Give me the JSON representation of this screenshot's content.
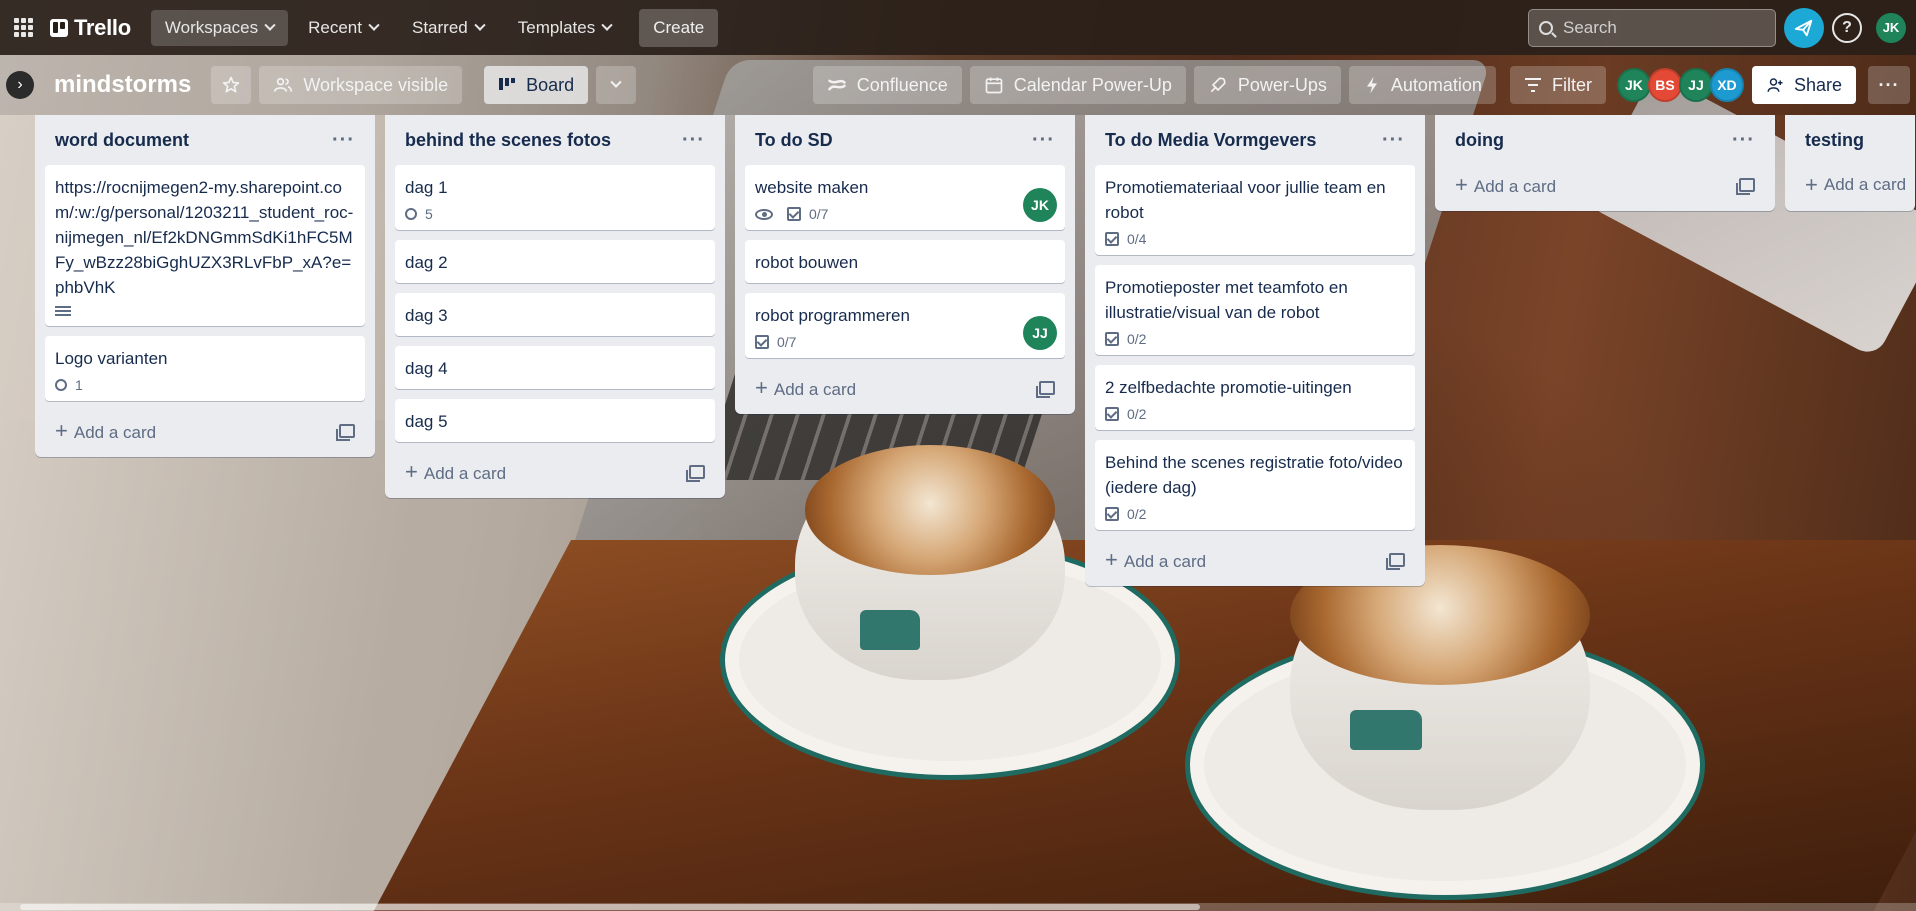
{
  "header": {
    "logo": "Trello",
    "nav": [
      {
        "label": "Workspaces"
      },
      {
        "label": "Recent"
      },
      {
        "label": "Starred"
      },
      {
        "label": "Templates"
      }
    ],
    "create_label": "Create",
    "search_placeholder": "Search",
    "user_initials": "JK",
    "colors": {
      "bar": "#281e18",
      "notif": "#1da9d6",
      "user": "#1f845a"
    }
  },
  "board": {
    "title": "mindstorms",
    "visibility_label": "Workspace visible",
    "view_label": "Board",
    "powerups": [
      {
        "label": "Confluence",
        "icon": "confluence-icon"
      },
      {
        "label": "Calendar Power-Up",
        "icon": "calendar-icon"
      },
      {
        "label": "Power-Ups",
        "icon": "rocket-icon"
      },
      {
        "label": "Automation",
        "icon": "lightning-icon"
      }
    ],
    "filter_label": "Filter",
    "members": [
      {
        "initials": "JK",
        "color": "#1f845a"
      },
      {
        "initials": "BS",
        "color": "#e34935"
      },
      {
        "initials": "JJ",
        "color": "#1f845a"
      },
      {
        "initials": "XD",
        "color": "#1d9bd1"
      }
    ],
    "share_label": "Share"
  },
  "lists": [
    {
      "title": "word document",
      "cards": [
        {
          "title": "https://rocnijmegen2-my.sharepoint.com/:w:/g/personal/1203211_student_roc-nijmegen_nl/Ef2kDNGmmSdKi1hFC5MFy_wBzz28biGghUZX3RLvFbP_xA?e=phbVhK",
          "description": true
        },
        {
          "title": "Logo varianten",
          "attachments": "1"
        }
      ],
      "add_label": "Add a card"
    },
    {
      "title": "behind the scenes fotos",
      "cards": [
        {
          "title": "dag 1",
          "attachments": "5"
        },
        {
          "title": "dag 2"
        },
        {
          "title": "dag 3"
        },
        {
          "title": "dag 4"
        },
        {
          "title": "dag 5"
        }
      ],
      "add_label": "Add a card"
    },
    {
      "title": "To do SD",
      "cards": [
        {
          "title": "website maken",
          "watching": true,
          "checklist": "0/7",
          "member": "JK"
        },
        {
          "title": "robot bouwen"
        },
        {
          "title": "robot programmeren",
          "checklist": "0/7",
          "member": "JJ"
        }
      ],
      "add_label": "Add a card"
    },
    {
      "title": "To do Media Vormgevers",
      "cards": [
        {
          "title": "Promotiemateriaal voor jullie team en robot",
          "checklist": "0/4"
        },
        {
          "title": "Promotieposter met teamfoto en illustratie/visual van de robot",
          "checklist": "0/2"
        },
        {
          "title": "2 zelfbedachte promotie-uitingen",
          "checklist": "0/2"
        },
        {
          "title": "Behind the scenes registratie foto/video (iedere dag)",
          "checklist": "0/2"
        }
      ],
      "add_label": "Add a card"
    },
    {
      "title": "doing",
      "cards": [],
      "add_label": "Add a card"
    },
    {
      "title": "testing",
      "cards": [],
      "add_label": "Add a card"
    }
  ]
}
